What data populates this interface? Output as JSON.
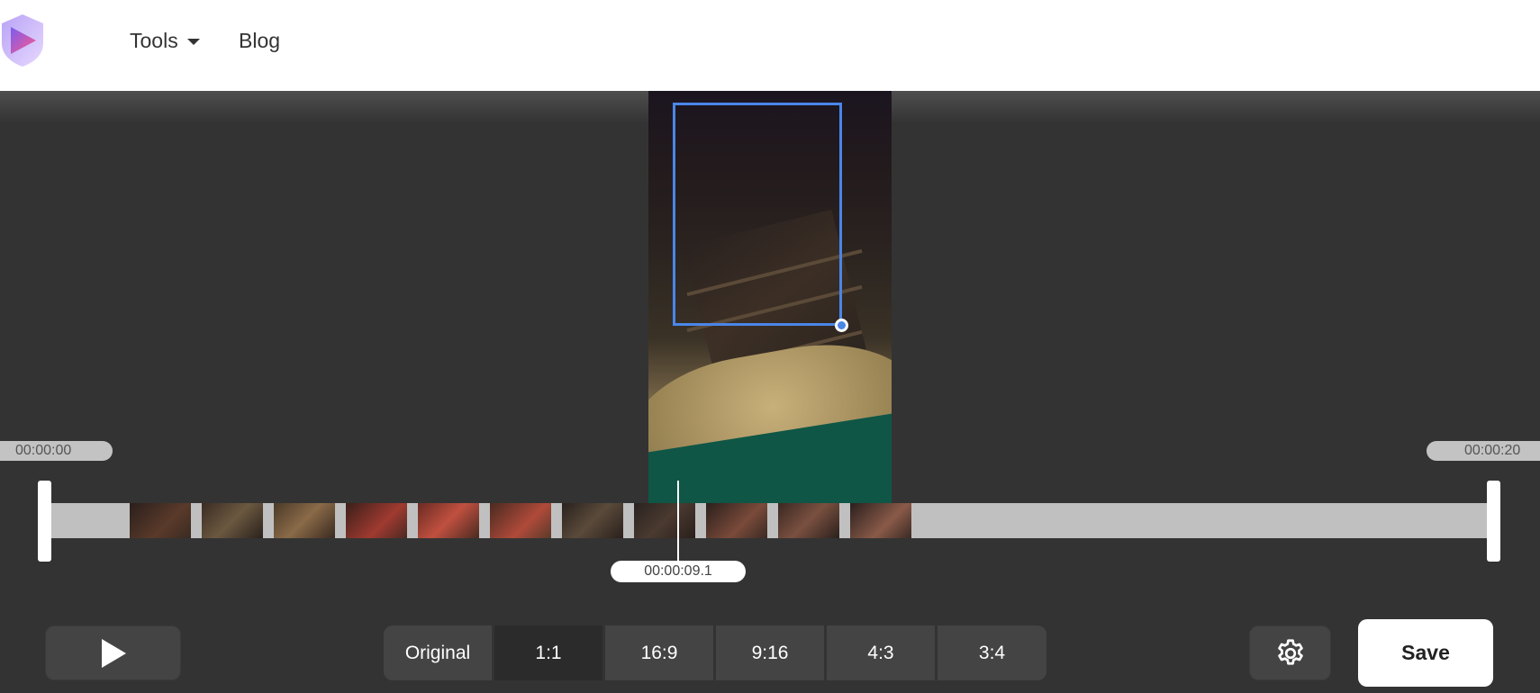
{
  "header": {
    "nav": {
      "tools_label": "Tools",
      "blog_label": "Blog"
    }
  },
  "timeline": {
    "start_time": "00:00:00",
    "end_time": "00:00:20",
    "current_time": "00:00:09.1"
  },
  "aspect_ratios": {
    "options": [
      "Original",
      "1:1",
      "16:9",
      "9:16",
      "4:3",
      "3:4"
    ],
    "selected": "1:1"
  },
  "actions": {
    "save_label": "Save"
  },
  "colors": {
    "accent": "#4a86e8",
    "background": "#333333",
    "control": "#444444",
    "control_active": "#2b2b2b",
    "track": "#c0c0c0"
  },
  "icons": {
    "logo": "logo-shield-play-icon",
    "play": "play-icon",
    "settings": "gear-icon",
    "tools_caret": "caret-down-icon"
  }
}
